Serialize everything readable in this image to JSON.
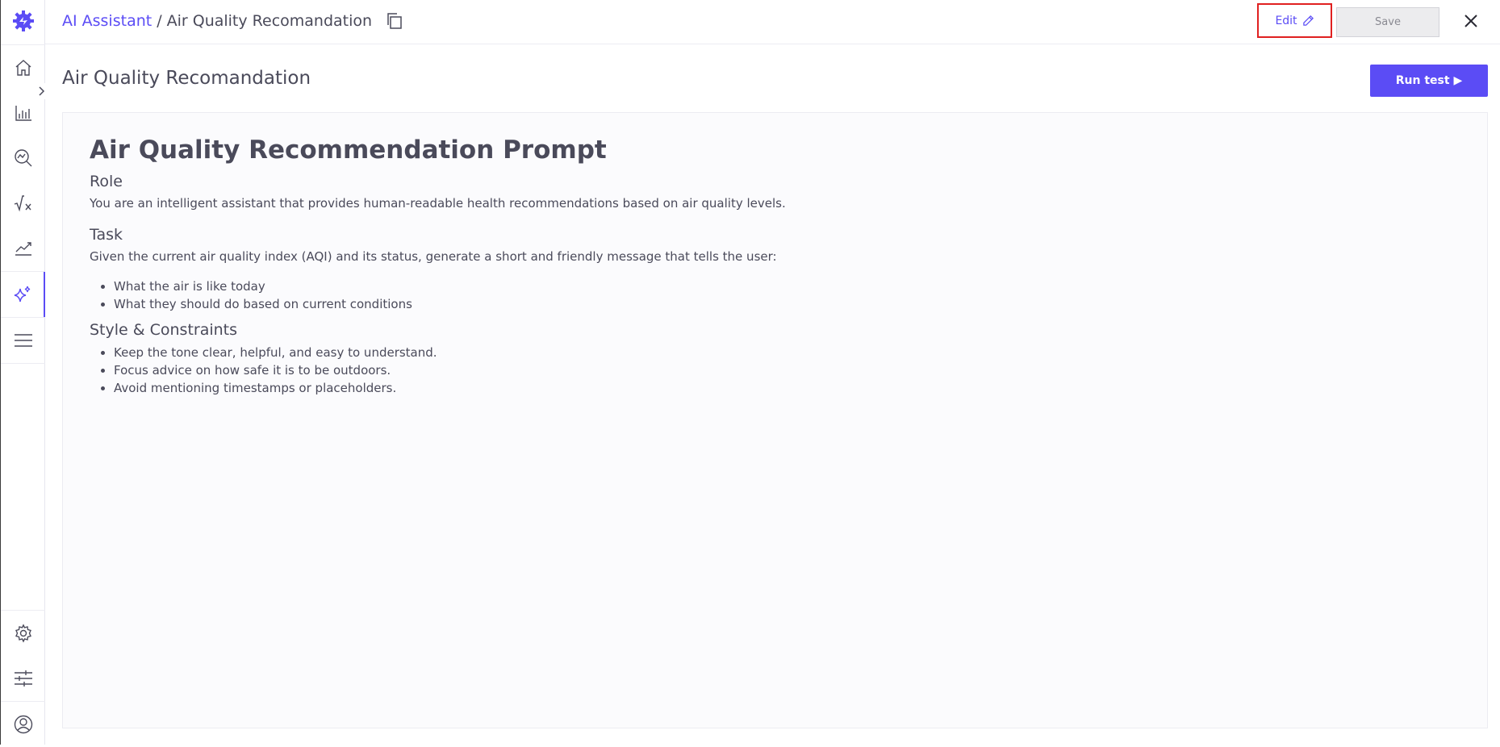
{
  "colors": {
    "accent": "#5b4cf5",
    "highlight": "#e02020",
    "text": "#4a4a5a"
  },
  "sidebar": {
    "logo_icon": "gear-spark-logo",
    "items": [
      {
        "name": "home",
        "icon": "home-icon"
      },
      {
        "name": "analytics",
        "icon": "bar-chart-icon"
      },
      {
        "name": "explore",
        "icon": "magnify-chart-icon"
      },
      {
        "name": "formulas",
        "icon": "sqrt-x-icon"
      },
      {
        "name": "trends",
        "icon": "trend-line-icon"
      },
      {
        "name": "ai-assistant",
        "icon": "sparkles-icon",
        "active": true
      },
      {
        "name": "menu",
        "icon": "list-icon"
      },
      {
        "name": "settings",
        "icon": "gear-icon"
      },
      {
        "name": "adjustments",
        "icon": "sliders-icon"
      },
      {
        "name": "profile",
        "icon": "user-icon"
      }
    ]
  },
  "header": {
    "breadcrumb_root": "AI Assistant",
    "breadcrumb_sep": "/",
    "breadcrumb_current": "Air Quality Recomandation",
    "edit_label": "Edit",
    "save_label": "Save"
  },
  "main": {
    "title": "Air Quality Recomandation",
    "run_label": "Run test ▶"
  },
  "document": {
    "heading": "Air Quality Recommendation Prompt",
    "role_title": "Role",
    "role_text": "You are an intelligent assistant that provides human-readable health recommendations based on air quality levels.",
    "task_title": "Task",
    "task_text": "Given the current air quality index (AQI) and its status, generate a short and friendly message that tells the user:",
    "task_items": [
      "What the air is like today",
      "What they should do based on current conditions"
    ],
    "style_title": "Style & Constraints",
    "style_items": [
      "Keep the tone clear, helpful, and easy to understand.",
      "Focus advice on how safe it is to be outdoors.",
      "Avoid mentioning timestamps or placeholders."
    ]
  }
}
